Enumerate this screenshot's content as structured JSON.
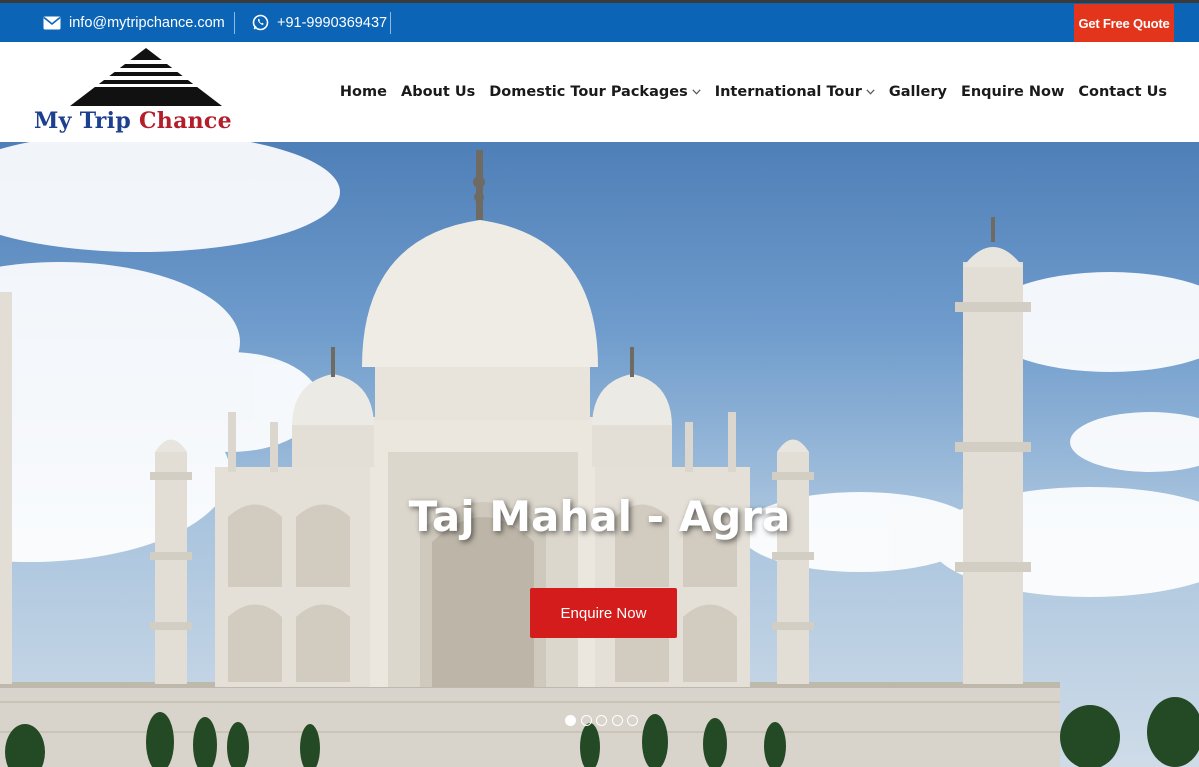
{
  "topbar": {
    "email": "info@mytripchance.com",
    "email_icon": "envelope-icon",
    "phone": "+91-9990369437",
    "phone_icon": "whatsapp-icon",
    "quote_button": "Get Free Quote"
  },
  "logo": {
    "word1": "My Trip ",
    "word2": "Chance"
  },
  "nav": {
    "items": [
      {
        "label": "Home",
        "dropdown": false
      },
      {
        "label": "About Us",
        "dropdown": false
      },
      {
        "label": "Domestic Tour Packages",
        "dropdown": true
      },
      {
        "label": "International Tour",
        "dropdown": true
      },
      {
        "label": "Gallery",
        "dropdown": false
      },
      {
        "label": "Enquire Now",
        "dropdown": false
      },
      {
        "label": "Contact Us",
        "dropdown": false
      }
    ]
  },
  "hero": {
    "title": "Taj Mahal - Agra",
    "button": "Enquire Now",
    "slides_count": 5,
    "active_slide": 1
  },
  "colors": {
    "topbar": "#0b64b6",
    "quote_button": "#e2351b",
    "hero_button": "#d41c1c",
    "logo_blue": "#1c3f8f",
    "logo_red": "#b41d2a"
  }
}
